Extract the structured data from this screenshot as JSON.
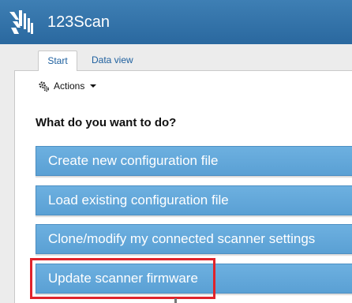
{
  "app": {
    "title": "123Scan"
  },
  "tabs": [
    {
      "label": "Start",
      "active": true
    },
    {
      "label": "Data view",
      "active": false
    }
  ],
  "toolbar": {
    "actions_label": "Actions"
  },
  "main": {
    "heading": "What do you want to do?",
    "buttons": [
      {
        "label": "Create new configuration file"
      },
      {
        "label": "Load existing configuration file"
      },
      {
        "label": "Clone/modify my connected scanner settings"
      },
      {
        "label": "Update scanner firmware",
        "highlighted": true
      }
    ]
  },
  "colors": {
    "titlebar": "#2f70a8",
    "button": "#5ea3d6",
    "tab_text": "#1d5f9e",
    "highlight": "#e0232b"
  }
}
